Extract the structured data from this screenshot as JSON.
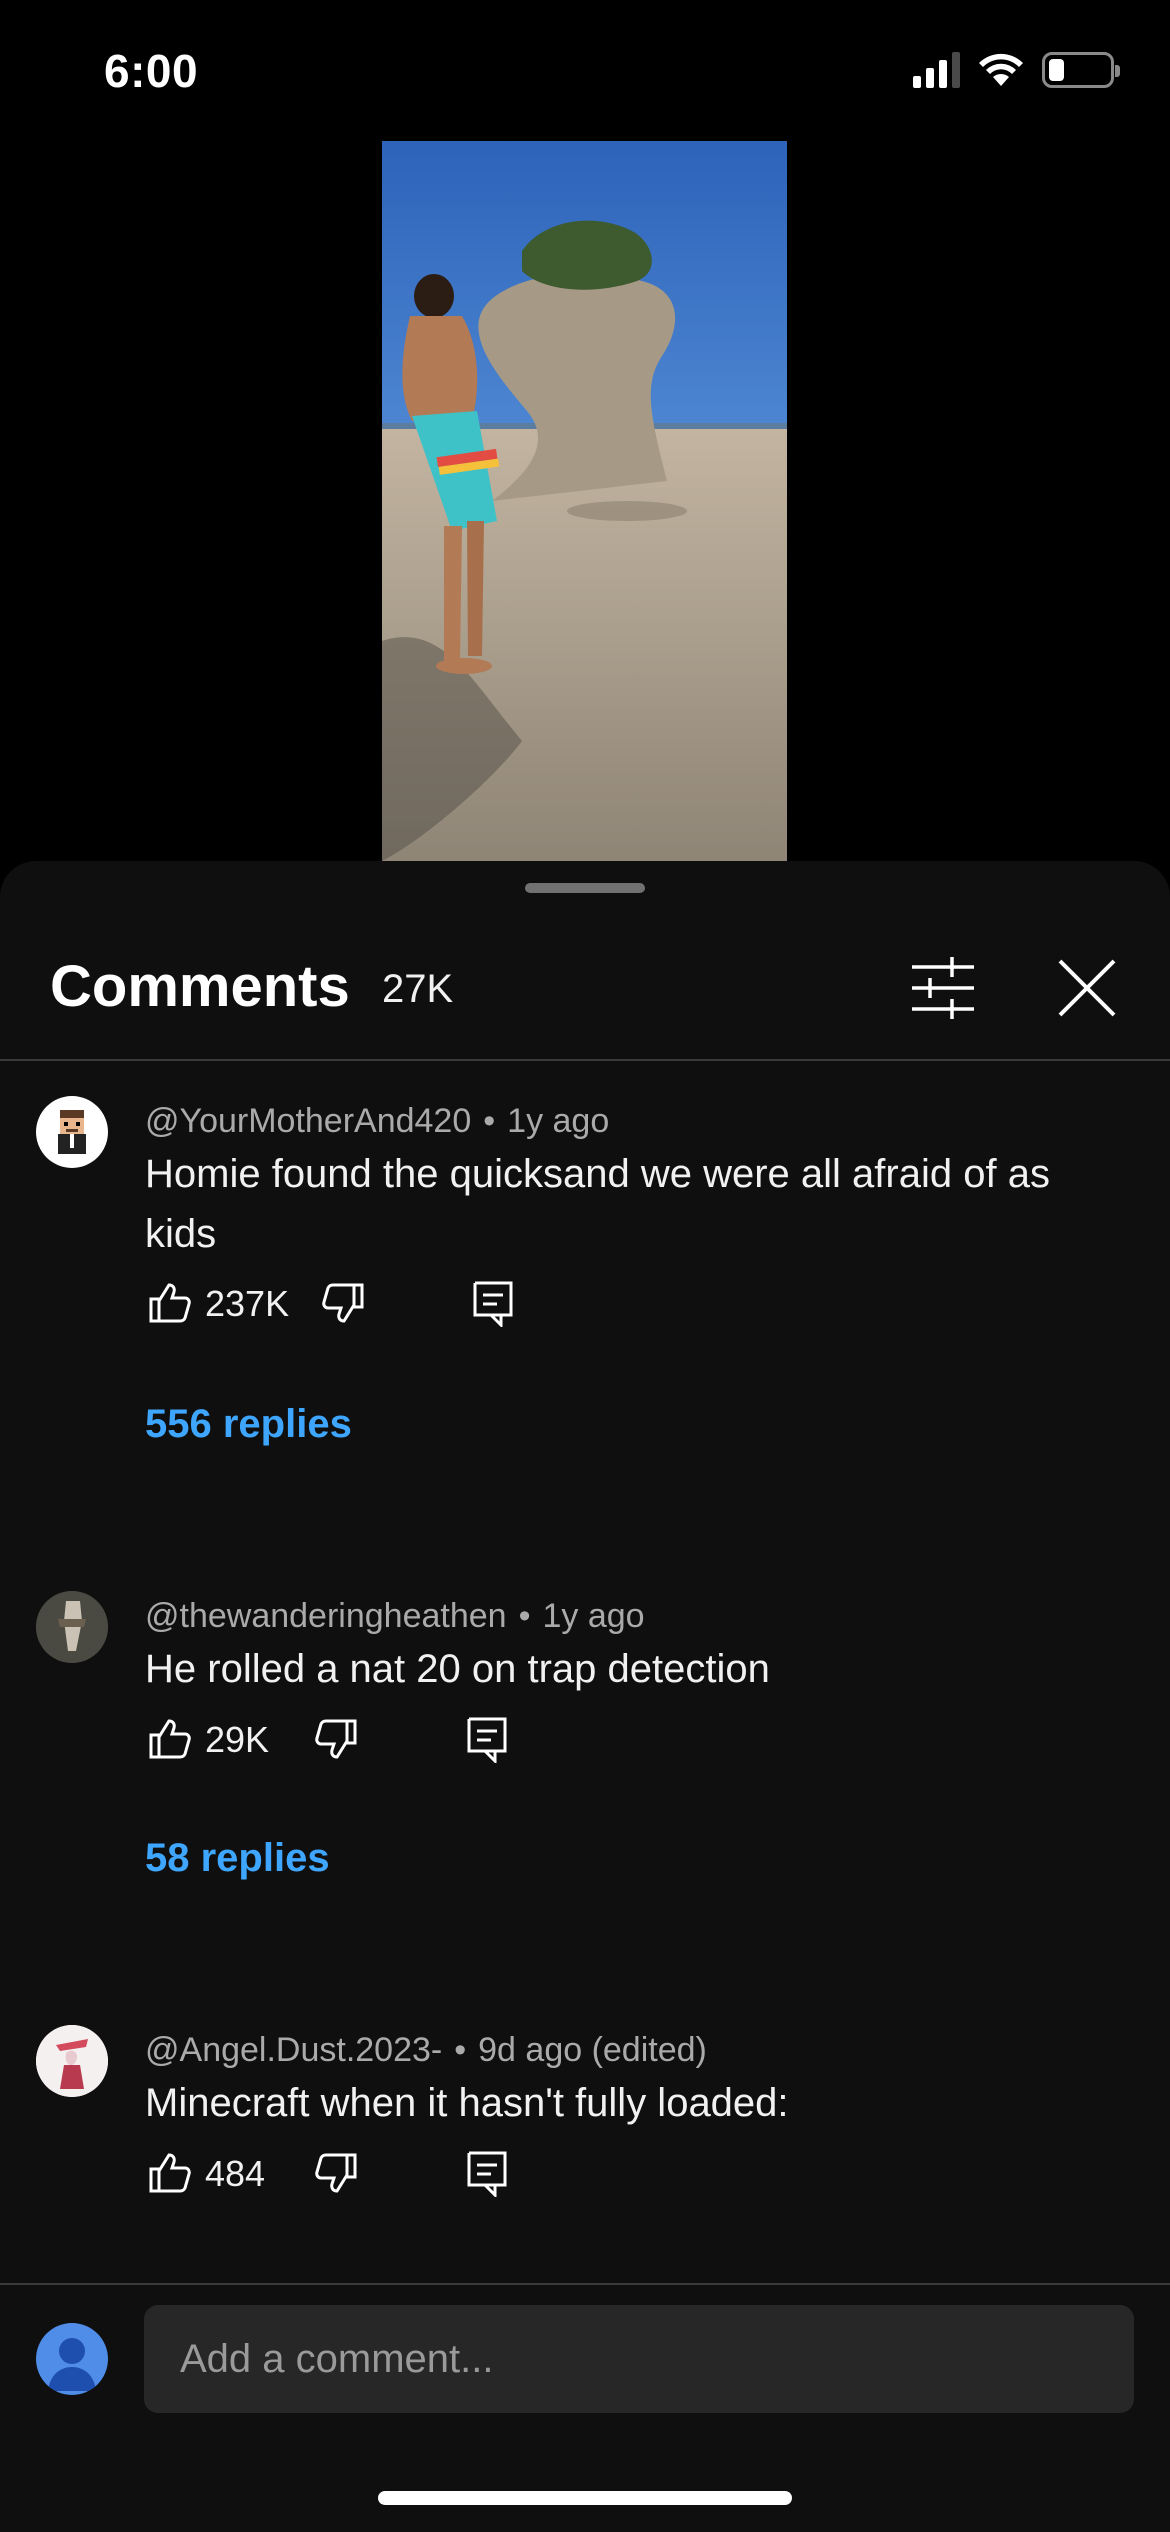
{
  "status_bar": {
    "time": "6:00",
    "icons": [
      "cellular-signal-icon",
      "wifi-icon",
      "battery-icon"
    ],
    "battery_level": 0.25
  },
  "video": {
    "icon": "video-thumbnail"
  },
  "comments_sheet": {
    "title": "Comments",
    "count": "27K",
    "filter_icon": "sliders-icon",
    "close_icon": "close-icon",
    "comments": [
      {
        "author": "@YourMotherAnd420",
        "time": "1y ago",
        "text": "Homie found the quicksand we were all afraid of as kids",
        "likes": "237K",
        "replies": "556 replies"
      },
      {
        "author": "@thewanderingheathen",
        "time": "1y ago",
        "text": "He rolled a nat 20 on trap detection",
        "likes": "29K",
        "replies": "58 replies"
      },
      {
        "author": "@Angel.Dust.2023-",
        "time": "9d ago (edited)",
        "text": "Minecraft when it hasn't fully loaded:",
        "likes": "484"
      }
    ]
  },
  "composer": {
    "placeholder": "Add a comment..."
  },
  "colors": {
    "background": "#0f0f0f",
    "link": "#3ea6ff",
    "input": "#272727"
  }
}
